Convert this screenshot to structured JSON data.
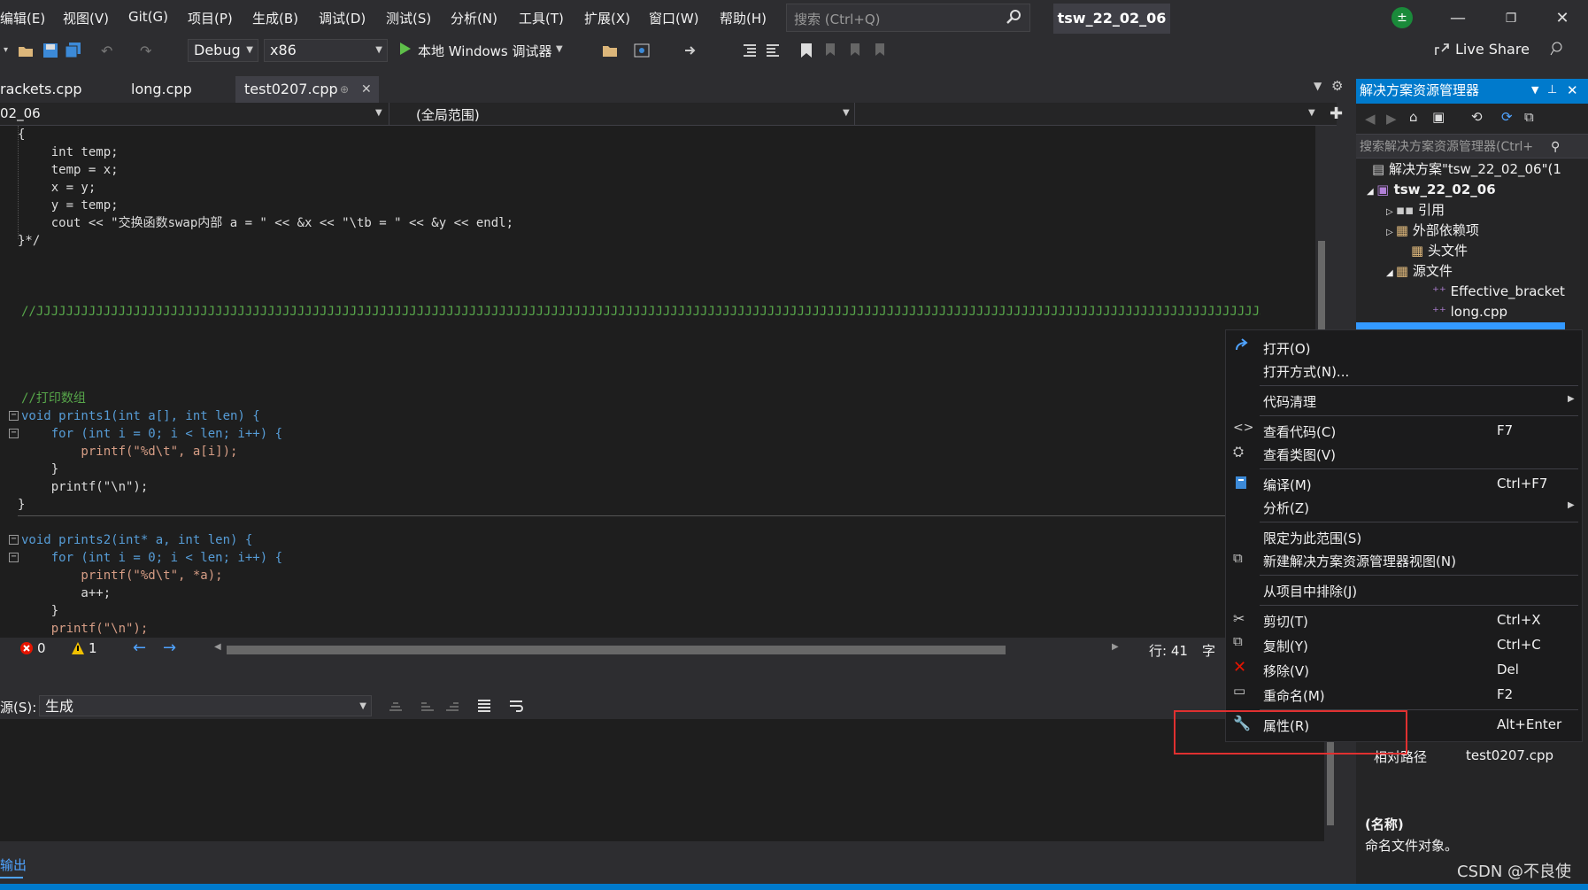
{
  "menu": [
    "编辑(E)",
    "视图(V)",
    "Git(G)",
    "项目(P)",
    "生成(B)",
    "调试(D)",
    "测试(S)",
    "分析(N)",
    "工具(T)",
    "扩展(X)",
    "窗口(W)",
    "帮助(H)"
  ],
  "search_placeholder": "搜索 (Ctrl+Q)",
  "solution_title": "tsw_22_02_06",
  "live_share": "Live Share",
  "toolbar": {
    "config": "Debug",
    "platform": "x86",
    "debugger": "本地 Windows 调试器"
  },
  "tabs": [
    "rackets.cpp",
    "long.cpp",
    "test0207.cpp"
  ],
  "nav": {
    "project": "02_06",
    "scope": "(全局范围)"
  },
  "code": [
    "{",
    "    int temp;",
    "    temp = x;",
    "    x = y;",
    "    y = temp;",
    "    cout << \"交换函数swap内部 a = \" << &x << \"\\tb = \" << &y << endl;",
    "}*/",
    "//JJJJJJJJJJJJJJJJJJJJJJJJJJJJJJJJJJJJJJJJJJJJJJJJJJJJJJJJJJJJJJJJJJJJJJJJJJJJJJJJJJJJJJJJJJJJJJJJJJJJJJJJJJJJJJJJJJJJJJJJJJJJJJJJJJJJJJJJJJJJJJJJJJJJJJJJJJJJJJJJJJJJJJJJJJJJJJJJJJJJJJJJJJJJJJ",
    "//打印数组",
    "void prints1(int a[], int len) {",
    "    for (int i = 0; i < len; i++) {",
    "        printf(\"%d\\t\", a[i]);",
    "    }",
    "    printf(\"\\n\");",
    "}",
    "void prints2(int* a, int len) {",
    "    for (int i = 0; i < len; i++) {",
    "        printf(\"%d\\t\", *a);",
    "        a++;",
    "    }",
    "    printf(\"\\n\");"
  ],
  "status": {
    "errors": "0",
    "warnings": "1",
    "line": "行: 41",
    "char": "字符"
  },
  "output": {
    "source_label": "源(S):",
    "source_value": "生成",
    "tab": "输出"
  },
  "solution_explorer": {
    "title": "解决方案资源管理器",
    "search": "搜索解决方案资源管理器(Ctrl+",
    "items": [
      "解决方案\"tsw_22_02_06\"(1",
      "tsw_22_02_06",
      "引用",
      "外部依赖项",
      "头文件",
      "源文件",
      "Effective_bracket",
      "long.cpp"
    ]
  },
  "properties": {
    "rel_path_label": "相对路径",
    "rel_path_value": "test0207.cpp",
    "name_label": "(名称)",
    "name_desc": "命名文件对象。"
  },
  "context_menu": [
    {
      "label": "打开(O)",
      "shortcut": ""
    },
    {
      "label": "打开方式(N)...",
      "shortcut": ""
    },
    {
      "label": "代码清理",
      "shortcut": ""
    },
    {
      "label": "查看代码(C)",
      "shortcut": "F7"
    },
    {
      "label": "查看类图(V)",
      "shortcut": ""
    },
    {
      "label": "编译(M)",
      "shortcut": "Ctrl+F7"
    },
    {
      "label": "分析(Z)",
      "shortcut": ""
    },
    {
      "label": "限定为此范围(S)",
      "shortcut": ""
    },
    {
      "label": "新建解决方案资源管理器视图(N)",
      "shortcut": ""
    },
    {
      "label": "从项目中排除(J)",
      "shortcut": ""
    },
    {
      "label": "剪切(T)",
      "shortcut": "Ctrl+X"
    },
    {
      "label": "复制(Y)",
      "shortcut": "Ctrl+C"
    },
    {
      "label": "移除(V)",
      "shortcut": "Del"
    },
    {
      "label": "重命名(M)",
      "shortcut": "F2"
    },
    {
      "label": "属性(R)",
      "shortcut": "Alt+Enter"
    }
  ],
  "watermark": "CSDN @不良使",
  "colors": {
    "accent": "#007acc",
    "highlight": "#e03030",
    "keyword": "#569cd6",
    "comment": "#57a64a"
  }
}
